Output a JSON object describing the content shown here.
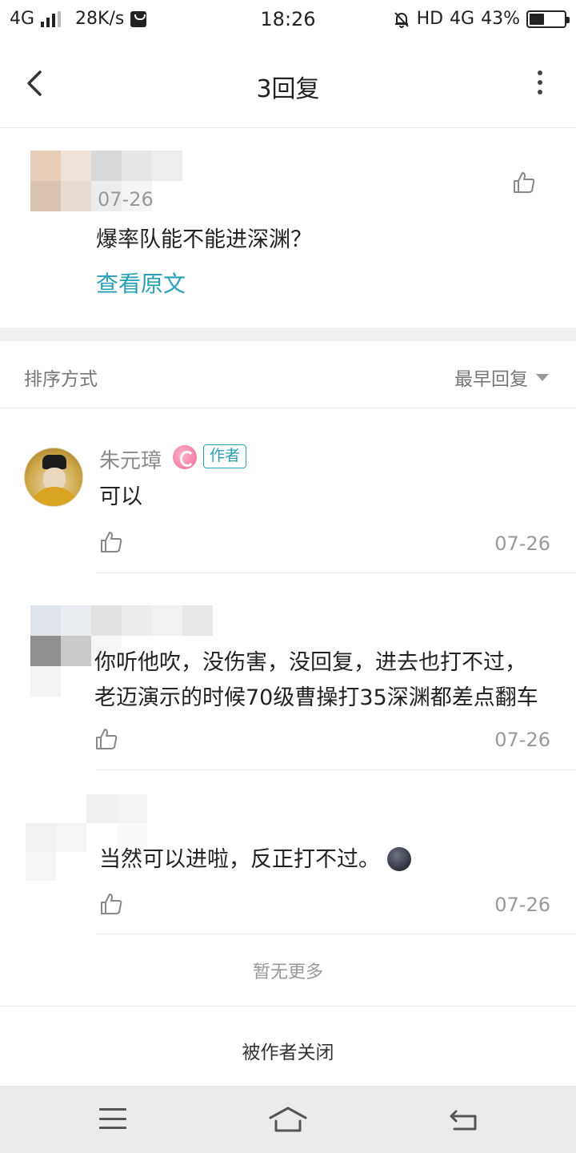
{
  "status_bar": {
    "network": "4G",
    "speed": "28K/s",
    "time": "18:26",
    "hd": "HD",
    "data_network": "4G",
    "battery_percent": "43%",
    "battery_level": 0.43
  },
  "header": {
    "title": "3回复"
  },
  "original_post": {
    "date": "07-26",
    "text": "爆率队能不能进深渊？",
    "view_original": "查看原文"
  },
  "sort": {
    "label": "排序方式",
    "selected": "最早回复"
  },
  "replies": [
    {
      "username": "朱元璋",
      "author_tag": "作者",
      "text": "可以",
      "date": "07-26"
    },
    {
      "text_line1": "你听他吹，没伤害，没回复，进去也打不过，",
      "text_line2": "老迈演示的时候70级曹操打35深渊都差点翻车",
      "date": "07-26"
    },
    {
      "text": "当然可以进啦，反正打不过。",
      "emoji": "new-moon-face-emoji",
      "date": "07-26"
    }
  ],
  "footer": {
    "no_more": "暂无更多",
    "closed": "被作者关闭"
  },
  "icons": {
    "back": "back-arrow-icon",
    "more": "more-vertical-icon",
    "like": "thumbs-up-icon",
    "dropdown": "caret-down-icon"
  },
  "colors": {
    "accent": "#2aa0b8",
    "secondary_text": "#999999",
    "divider": "#ececec",
    "band": "#f0f0f0"
  }
}
